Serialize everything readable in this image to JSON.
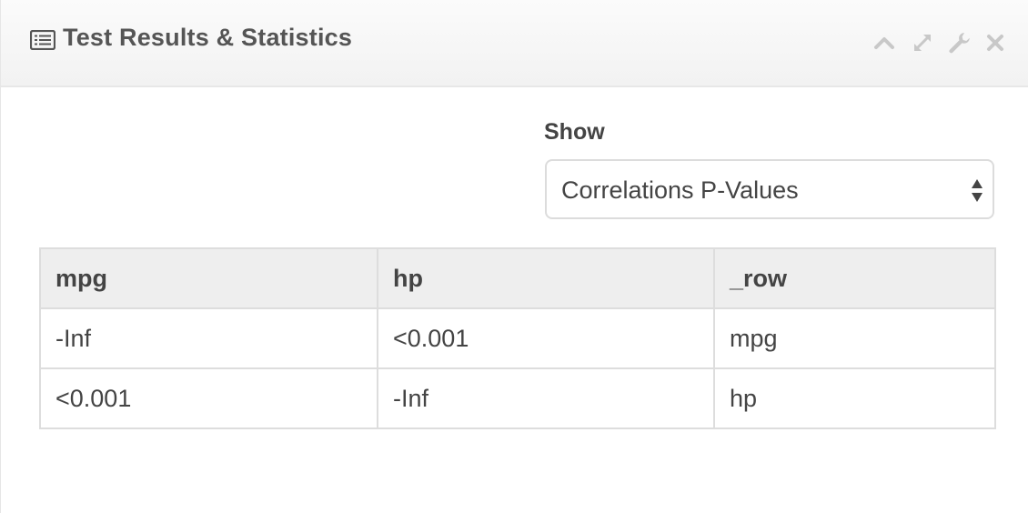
{
  "panel": {
    "title": "Test Results & Statistics",
    "header_icon": "list-icon",
    "tools": [
      "collapse-icon",
      "expand-icon",
      "wrench-icon",
      "close-icon"
    ]
  },
  "controls": {
    "show_label": "Show",
    "show_select": {
      "selected": "Correlations P-Values"
    }
  },
  "table": {
    "columns": [
      "mpg",
      "hp",
      "_row"
    ],
    "rows": [
      [
        "-Inf",
        "<0.001",
        "mpg"
      ],
      [
        "<0.001",
        "-Inf",
        "hp"
      ]
    ]
  },
  "colors": {
    "header_bg": "#f2f2f2",
    "title_text": "#555555",
    "tool_icon": "#c8c8c8",
    "table_border": "#dddddd",
    "table_header_bg": "#eeeeee"
  }
}
